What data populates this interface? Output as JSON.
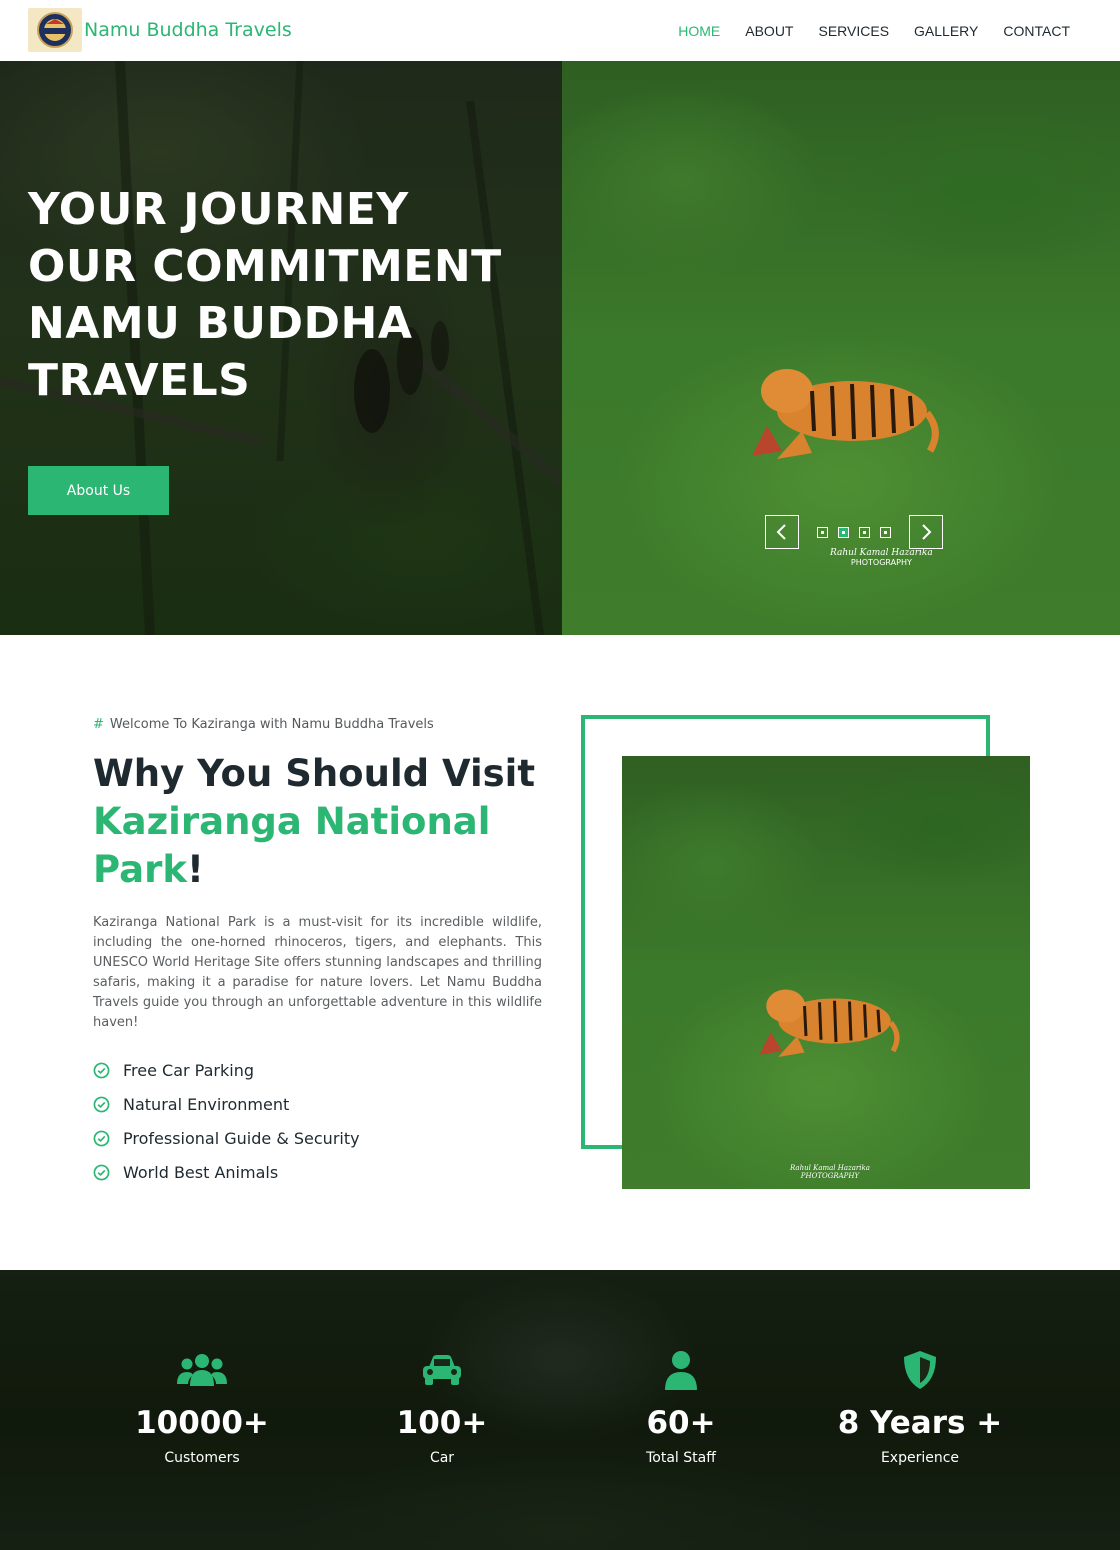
{
  "colors": {
    "accent": "#2bb673",
    "text": "#1e2a30",
    "muted": "#5a5e61"
  },
  "brand": {
    "name": "Namu Buddha Travels",
    "logo_icon": "nbt-logo-icon"
  },
  "nav": {
    "items": [
      {
        "label": "HOME",
        "active": true
      },
      {
        "label": "ABOUT",
        "active": false
      },
      {
        "label": "SERVICES",
        "active": false
      },
      {
        "label": "GALLERY",
        "active": false
      },
      {
        "label": "CONTACT",
        "active": false
      }
    ]
  },
  "hero": {
    "title_lines": [
      "YOUR JOURNEY",
      "OUR COMMITMENT",
      "NAMU BUDDHA",
      "TRAVELS"
    ],
    "button_label": "About Us",
    "slider": {
      "slide_count": 4,
      "active_slide": 2
    },
    "watermark": {
      "line1": "Rahul Kamal Hazarika",
      "line2": "PHOTOGRAPHY"
    }
  },
  "about": {
    "eyebrow_hash": "#",
    "eyebrow": "Welcome To Kaziranga with Namu Buddha Travels",
    "title_part1": "Why You Should Visit",
    "title_highlight": "Kaziranga National Park",
    "title_end": "!",
    "body": "Kaziranga National Park is a must-visit for its incredible wildlife, including the one-horned rhinoceros, tigers, and elephants. This UNESCO World Heritage Site offers stunning landscapes and thrilling safaris, making it a paradise for nature lovers. Let Namu Buddha Travels guide you through an unforgettable adventure in this wildlife haven!",
    "features": [
      "Free Car Parking",
      "Natural Environment",
      "Professional Guide & Security",
      "World Best Animals"
    ],
    "image_watermark": {
      "line1": "Rahul Kamal Hazarika",
      "line2": "PHOTOGRAPHY"
    }
  },
  "stats": [
    {
      "icon": "users-icon",
      "value": "10000+",
      "label": "Customers"
    },
    {
      "icon": "car-icon",
      "value": "100+",
      "label": "Car"
    },
    {
      "icon": "user-icon",
      "value": "60+",
      "label": "Total Staff"
    },
    {
      "icon": "shield-icon",
      "value": "8 Years +",
      "label": "Experience"
    }
  ]
}
